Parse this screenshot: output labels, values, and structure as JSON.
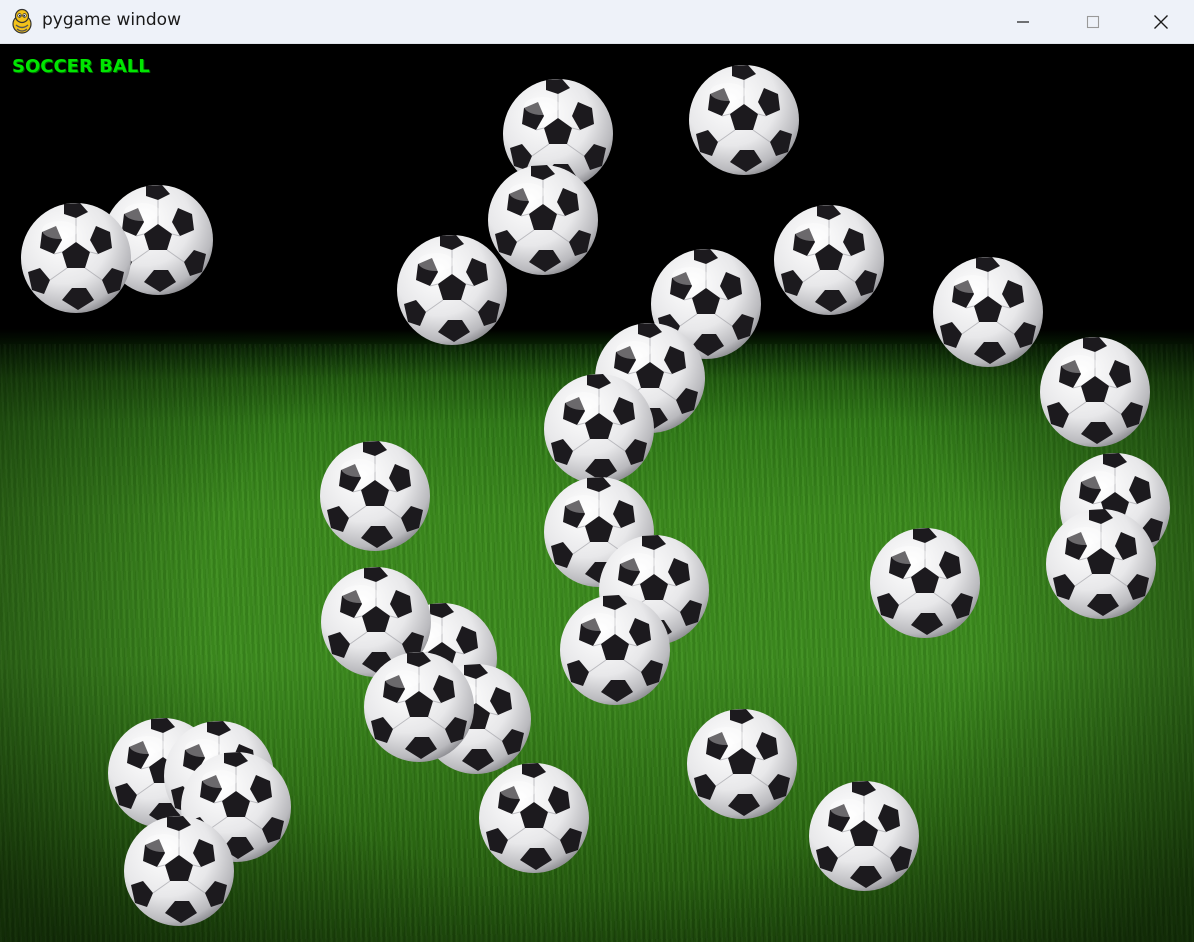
{
  "window": {
    "title": "pygame window"
  },
  "window_controls": {
    "minimize_icon": "minimize-icon",
    "maximize_icon": "maximize-icon",
    "close_icon": "close-icon"
  },
  "game": {
    "title": "SOCCER BALL",
    "title_color": "#00e600",
    "ball_count": 34
  }
}
